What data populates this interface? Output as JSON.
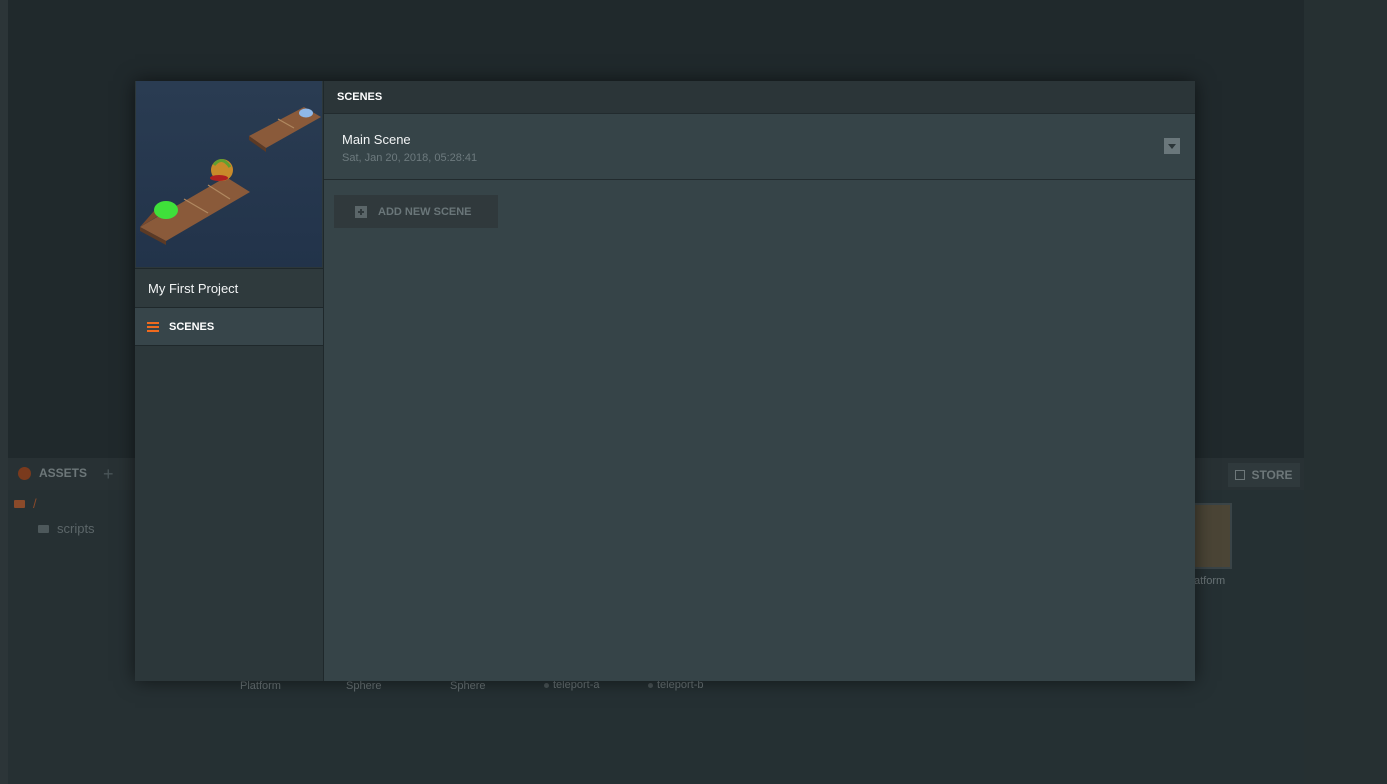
{
  "background": {
    "assets": {
      "title": "ASSETS",
      "add_symbol": "+",
      "store_label": "STORE",
      "tree": [
        {
          "label": "/",
          "icon": "folder-icon"
        },
        {
          "label": "scripts",
          "icon": "folder-icon"
        }
      ],
      "items": [
        {
          "label": "Platform"
        },
        {
          "label": "Sphere"
        },
        {
          "label": "Sphere"
        },
        {
          "label": "teleport-a"
        },
        {
          "label": "teleport-b"
        },
        {
          "label": "atform"
        }
      ]
    }
  },
  "dialog": {
    "project": {
      "name": "My First Project"
    },
    "nav": [
      {
        "label": "SCENES",
        "icon": "list-icon",
        "active": true
      }
    ],
    "header": "SCENES",
    "scenes": [
      {
        "name": "Main Scene",
        "date": "Sat, Jan 20, 2018, 05:28:41"
      }
    ],
    "add_scene_label": "ADD NEW SCENE"
  },
  "colors": {
    "accent": "#f06a1e",
    "modal_bg": "#364448",
    "sidebar_bg": "#2c373a",
    "page_bg": "#20272a"
  }
}
